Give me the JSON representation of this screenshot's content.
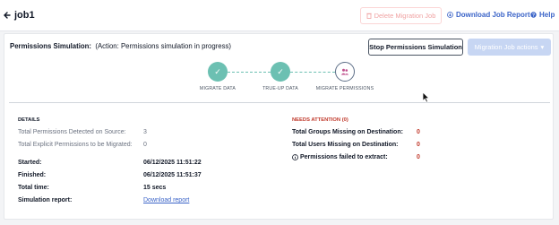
{
  "header": {
    "title": "job1",
    "delete_label": "Delete Migration Job",
    "download_label": "Download Job Report",
    "help_label": "Help"
  },
  "simulation": {
    "label": "Permissions Simulation:",
    "status": "(Action: Permissions simulation in progress)",
    "stop_label": "Stop Permissions Simulation",
    "actions_label": "Migration Job actions"
  },
  "steps": [
    {
      "label": "MIGRATE DATA",
      "state": "done",
      "icon": "check-icon"
    },
    {
      "label": "TRUE-UP DATA",
      "state": "done",
      "icon": "check-icon"
    },
    {
      "label": "MIGRATE PERMISSIONS",
      "state": "current",
      "icon": "people-icon"
    }
  ],
  "details": {
    "title": "DETAILS",
    "perm_detected_label": "Total Permissions Detected on Source:",
    "perm_detected_value": "3",
    "explicit_label": "Total Explicit Permissions to be Migrated:",
    "explicit_value": "0",
    "started_label": "Started:",
    "started_value": "06/12/2025 11:51:22",
    "finished_label": "Finished:",
    "finished_value": "06/12/2025 11:51:37",
    "total_time_label": "Total time:",
    "total_time_value": "15 secs",
    "report_label": "Simulation report:",
    "report_link": "Download report"
  },
  "attention": {
    "title": "NEEDS ATTENTION (0)",
    "groups_label": "Total Groups Missing on Destination:",
    "groups_value": "0",
    "users_label": "Total Users Missing on Destination:",
    "users_value": "0",
    "failed_label": "Permissions failed to extract:",
    "failed_value": "0"
  },
  "colors": {
    "accent": "#3b64c8",
    "done": "#6cc0b2",
    "danger": "#c0392b"
  }
}
